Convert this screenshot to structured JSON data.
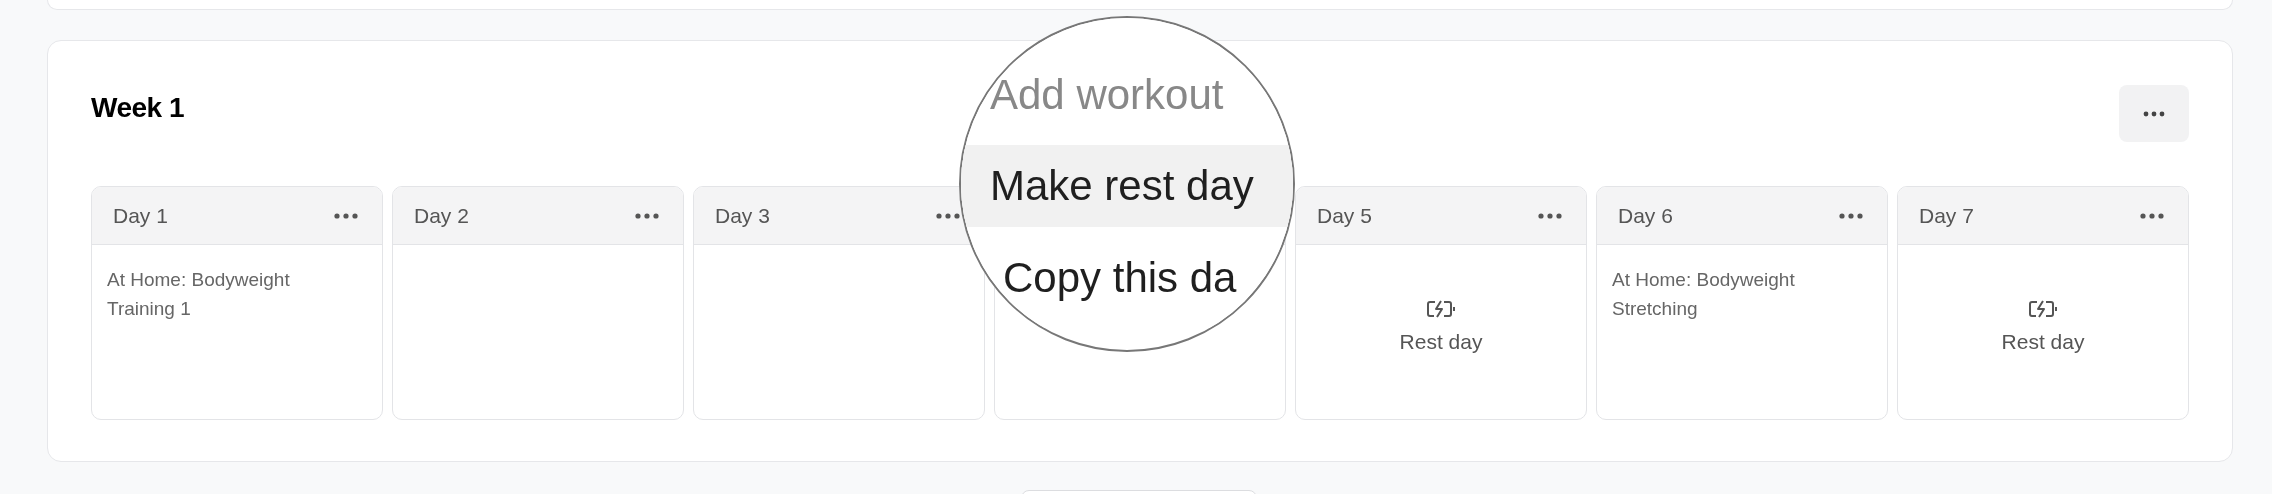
{
  "week": {
    "title": "Week 1",
    "days": [
      {
        "label": "Day 1",
        "kind": "workout",
        "workout": "At Home: Bodyweight Training 1"
      },
      {
        "label": "Day 2",
        "kind": "empty"
      },
      {
        "label": "Day 3",
        "kind": "empty"
      },
      {
        "kind": "empty"
      },
      {
        "label": "Day 5",
        "kind": "rest",
        "rest_label": "Rest day"
      },
      {
        "label": "Day 6",
        "kind": "workout",
        "workout": "At Home: Bodyweight Stretching"
      },
      {
        "label": "Day 7",
        "kind": "rest",
        "rest_label": "Rest day"
      }
    ]
  },
  "magnifier": {
    "menu": [
      {
        "label": "Add workout",
        "disabled": true,
        "selected": false
      },
      {
        "label": "Make rest day",
        "disabled": false,
        "selected": true
      },
      {
        "label": "Copy this da",
        "disabled": false,
        "selected": false
      }
    ]
  }
}
